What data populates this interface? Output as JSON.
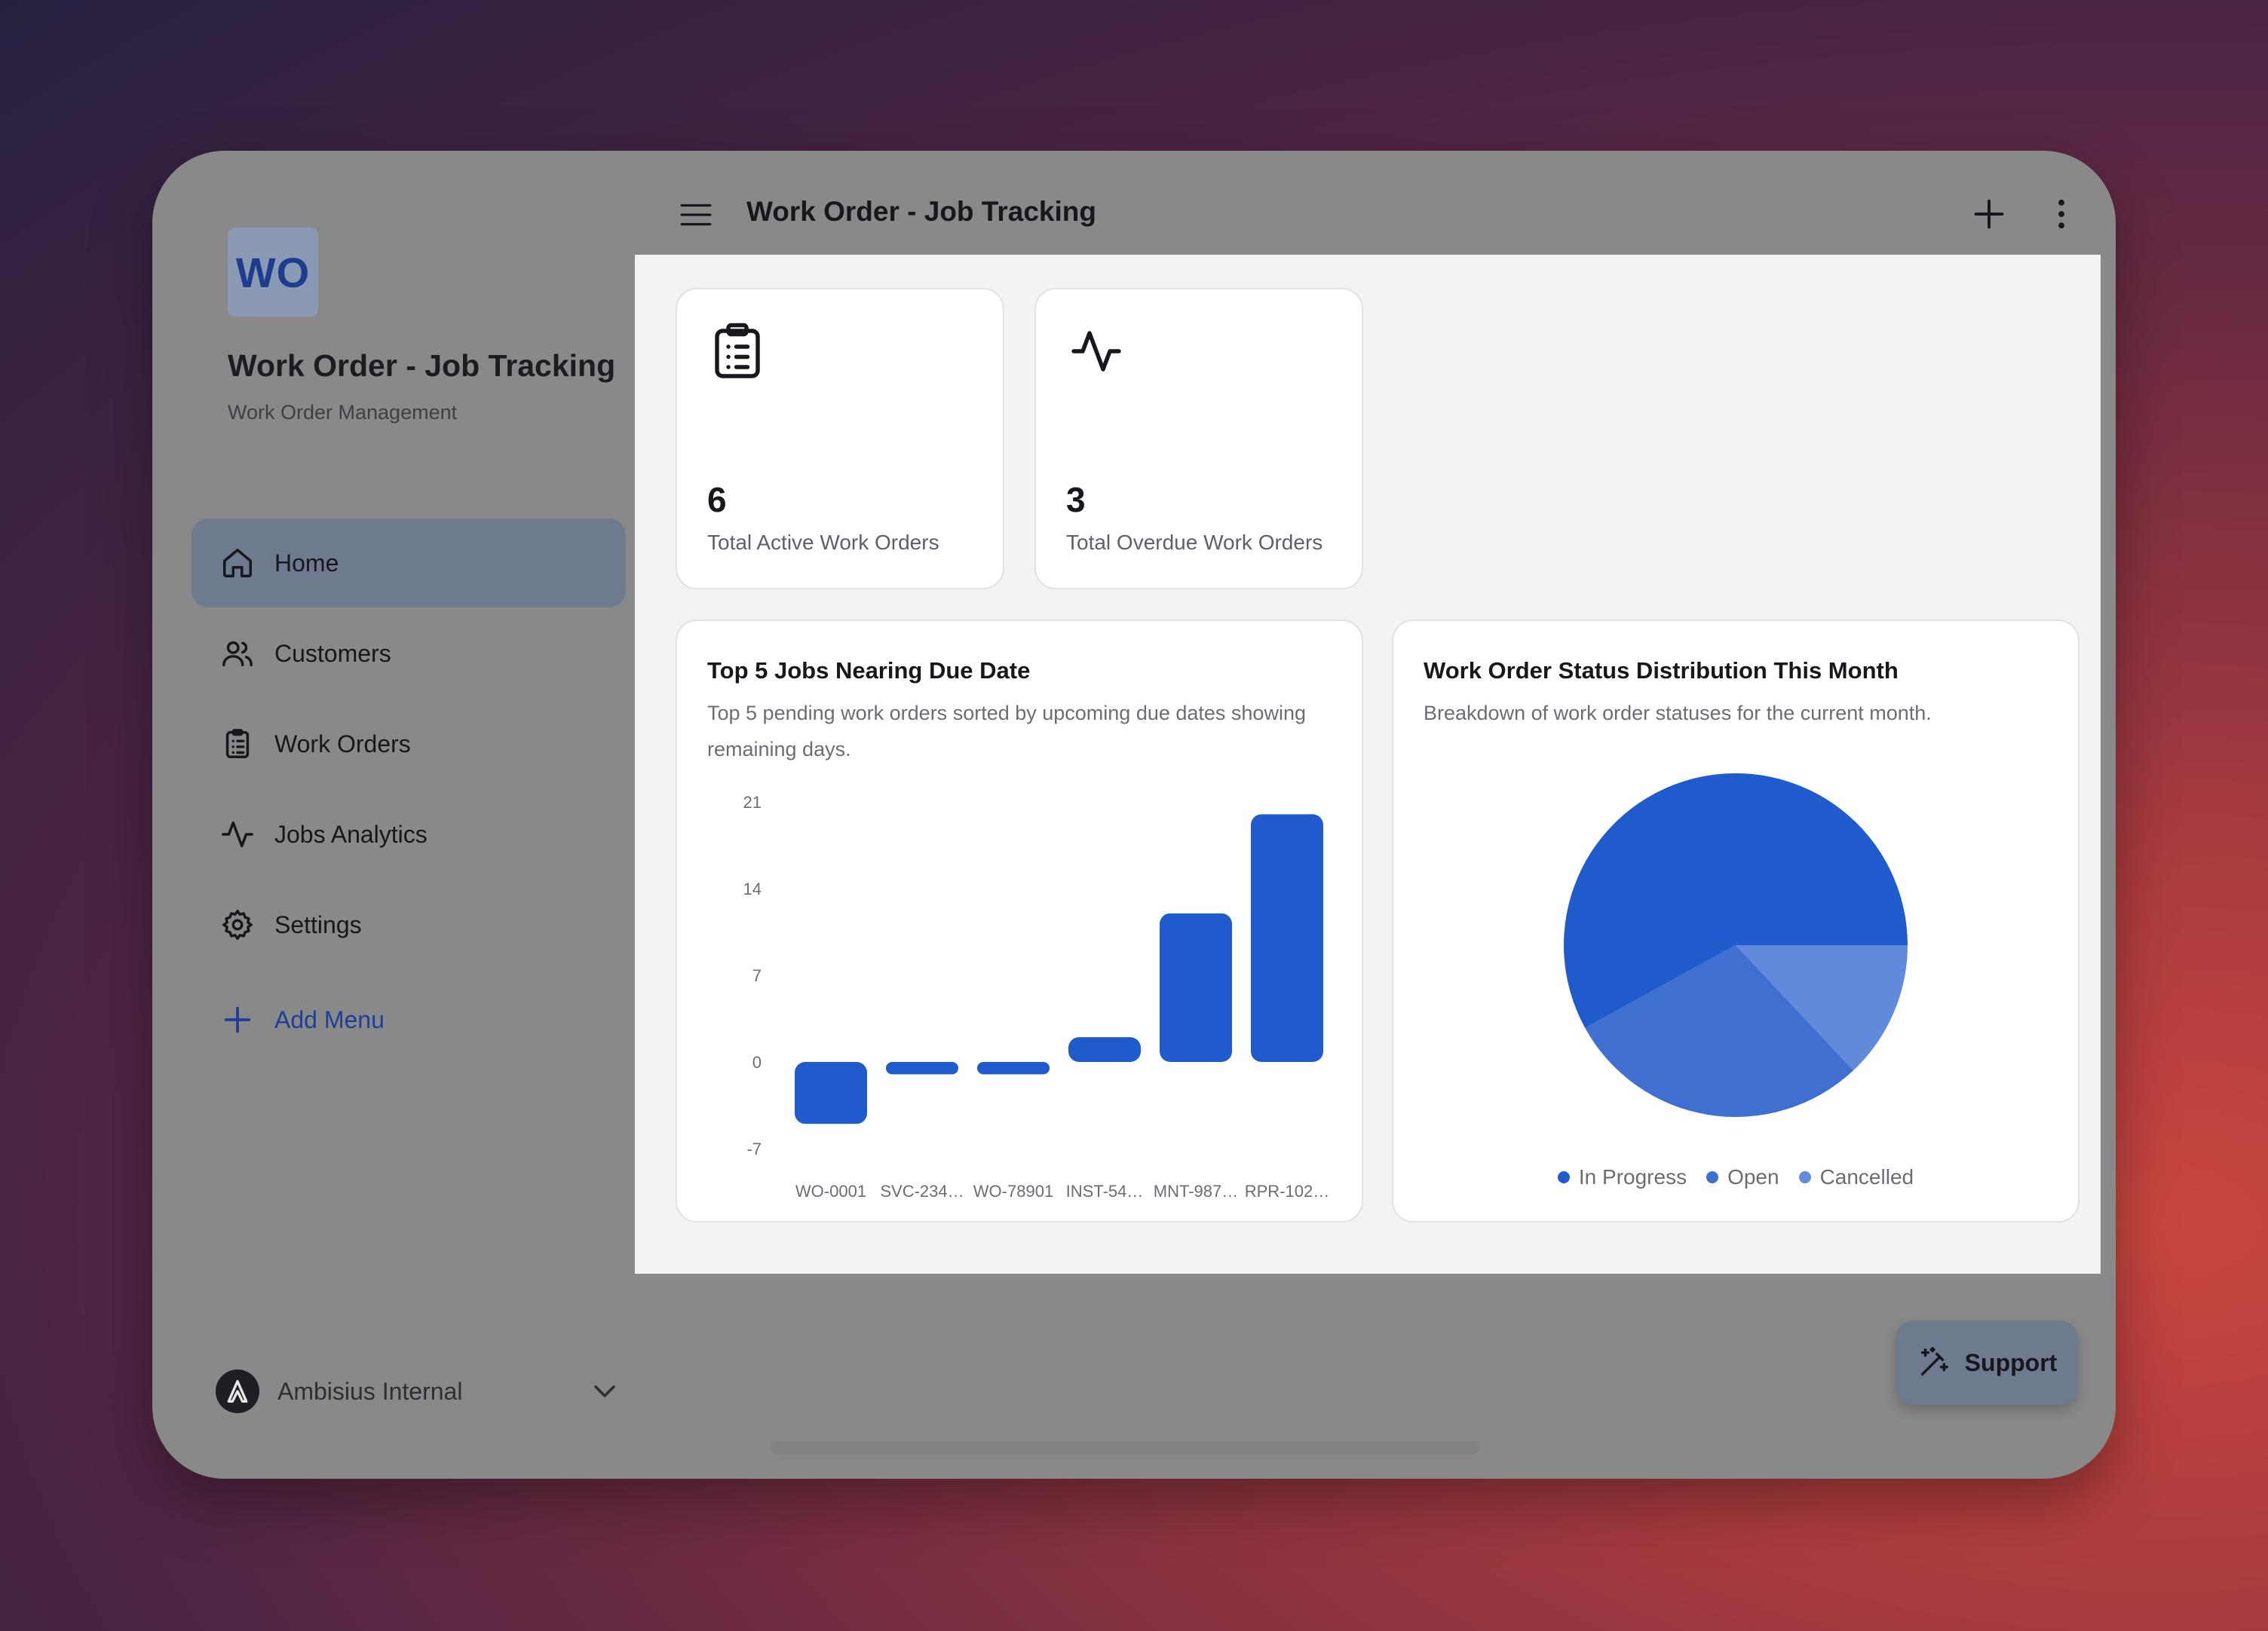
{
  "app": {
    "logo_text": "WO",
    "title": "Work Order - Job Tracking",
    "subtitle": "Work Order Management"
  },
  "header": {
    "title": "Work Order - Job Tracking"
  },
  "sidebar": {
    "items": [
      {
        "label": "Home",
        "icon": "home-icon",
        "active": true
      },
      {
        "label": "Customers",
        "icon": "users-icon",
        "active": false
      },
      {
        "label": "Work Orders",
        "icon": "clipboard-icon",
        "active": false
      },
      {
        "label": "Jobs Analytics",
        "icon": "activity-icon",
        "active": false
      },
      {
        "label": "Settings",
        "icon": "gear-icon",
        "active": false
      }
    ],
    "add_menu_label": "Add Menu",
    "org_name": "Ambisius Internal"
  },
  "stats": [
    {
      "value": "6",
      "label": "Total Active Work Orders",
      "icon": "clipboard-icon"
    },
    {
      "value": "3",
      "label": "Total Overdue Work Orders",
      "icon": "activity-icon"
    }
  ],
  "bar_card": {
    "title": "Top 5 Jobs Nearing Due Date",
    "description": "Top 5 pending work orders sorted by upcoming due dates showing remaining days."
  },
  "pie_card": {
    "title": "Work Order Status Distribution This Month",
    "description": "Breakdown of work order statuses for the current month."
  },
  "support_label": "Support",
  "colors": {
    "accent": "#1f5bcc",
    "accent_mid": "#3e6fd1",
    "accent_light": "#6189dc",
    "frame_gray": "#898989",
    "active_nav": "#6e7b8e"
  },
  "chart_data": [
    {
      "type": "bar",
      "title": "Top 5 Jobs Nearing Due Date",
      "categories": [
        "WO-0001",
        "SVC-234…",
        "WO-78901",
        "INST-54…",
        "MNT-987…",
        "RPR-102…"
      ],
      "values": [
        -5,
        -1,
        -1,
        2,
        12,
        20
      ],
      "yticks": [
        21,
        14,
        7,
        0,
        -7
      ],
      "ylim": [
        -7,
        21
      ],
      "color": "#1f5bcc"
    },
    {
      "type": "pie",
      "title": "Work Order Status Distribution This Month",
      "labels": [
        "In Progress",
        "Open",
        "Cancelled"
      ],
      "values": [
        58,
        29,
        13
      ],
      "colors": [
        "#1f5bcc",
        "#3e6fd1",
        "#6189dc"
      ]
    }
  ]
}
